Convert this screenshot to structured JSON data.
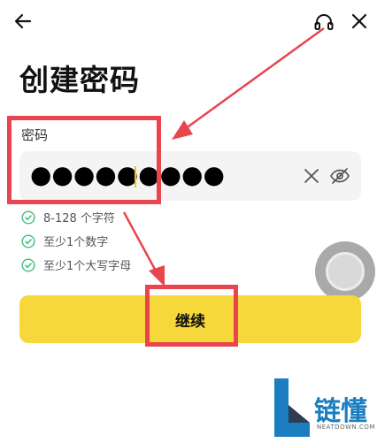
{
  "header": {
    "title": "创建密码"
  },
  "password": {
    "label": "密码",
    "masked_value": "●●●●●●●●●"
  },
  "rules": [
    {
      "text": "8-128 个字符",
      "met": true
    },
    {
      "text": "至少1个数字",
      "met": true
    },
    {
      "text": "至少1个大写字母",
      "met": true
    }
  ],
  "actions": {
    "continue_label": "继续"
  },
  "colors": {
    "accent": "#f7d83a",
    "check": "#3dbf7a",
    "annotation": "#e8454e",
    "field_bg": "#f4f4f4"
  },
  "watermark": {
    "text": "链懂",
    "subtext": "NEATDOWN.COM"
  }
}
